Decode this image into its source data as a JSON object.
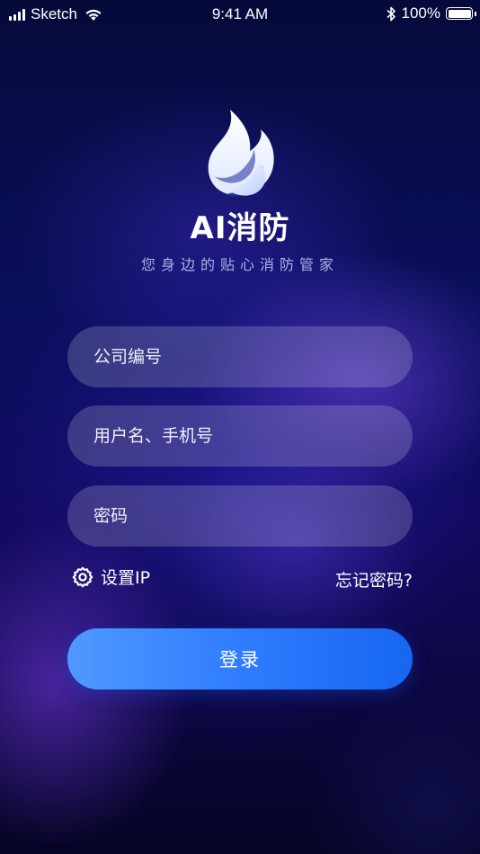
{
  "status_bar": {
    "carrier": "Sketch",
    "time": "9:41 AM",
    "battery": "100%",
    "battery_level": 1.0,
    "icons": [
      "signal-icon",
      "wifi-icon",
      "bluetooth-icon",
      "battery-icon"
    ]
  },
  "brand": {
    "name": "AI消防",
    "slogan": "您身边的贴心消防管家",
    "logo_icon": "flame-icon"
  },
  "form": {
    "company_placeholder": "公司编号",
    "username_placeholder": "用户名、手机号",
    "password_placeholder": "密码",
    "settings_label": "设置IP",
    "settings_icon": "gear-icon",
    "forgot_label": "忘记密码?",
    "login_label": "登录"
  },
  "colors": {
    "accent": "#2f7cff",
    "accent_light": "#4f99ff",
    "accent_dark": "#1766f0",
    "background": "#0a0f5c"
  }
}
